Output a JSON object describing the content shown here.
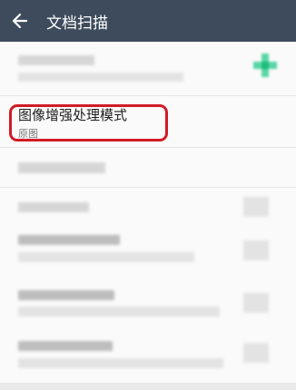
{
  "appbar": {
    "title": "文档扫描",
    "back_icon": "arrow-left-icon"
  },
  "settings": {
    "image_enhance": {
      "title": "图像增强处理模式",
      "value": "原图"
    }
  },
  "colors": {
    "appbar": "#3d4b5c",
    "highlight": "#d11b25",
    "accent_icon": "#39c98f"
  }
}
